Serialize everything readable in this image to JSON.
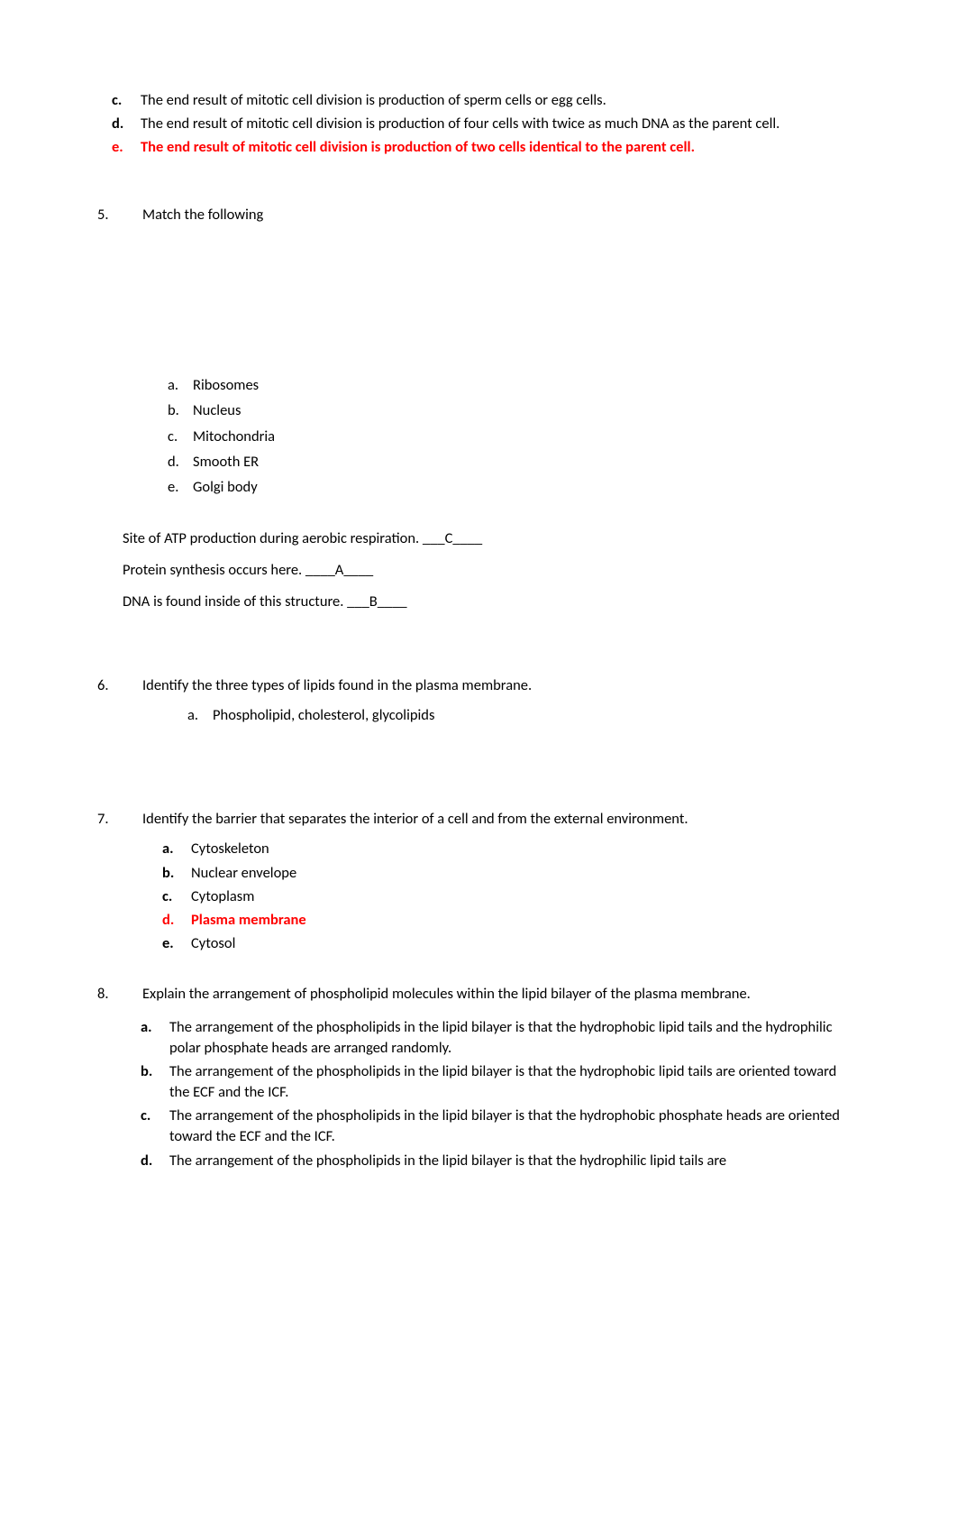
{
  "top": {
    "c": {
      "marker": "c.",
      "text": "The end result of mitotic cell division is production of sperm cells or egg cells."
    },
    "d": {
      "marker": "d.",
      "text": "The end result of mitotic cell division is production of four cells with twice as much DNA as the parent cell."
    },
    "e": {
      "marker": "e.",
      "text": "The end result of mitotic cell division is production of two cells identical to the parent cell."
    }
  },
  "q5": {
    "num": "5.",
    "prompt": "Match the following",
    "opts": {
      "a": {
        "marker": "a.",
        "text": "Ribosomes"
      },
      "b": {
        "marker": "b.",
        "text": "Nucleus"
      },
      "c": {
        "marker": "c.",
        "text": "Mitochondria"
      },
      "d": {
        "marker": "d.",
        "text": "Smooth ER"
      },
      "e": {
        "marker": "e.",
        "text": "Golgi body"
      }
    },
    "stmt1": "Site of ATP production during aerobic respiration. ___C____",
    "stmt2": "Protein synthesis occurs here. ____A____",
    "stmt3": "DNA is found inside of this structure. ___B____"
  },
  "q6": {
    "num": "6.",
    "prompt": "Identify the three types of lipids found in the plasma membrane.",
    "a": {
      "marker": "a.",
      "text": "Phospholipid, cholesterol, glycolipids"
    }
  },
  "q7": {
    "num": "7.",
    "prompt": "Identify the barrier that separates the interior of a cell and from the external environment.",
    "a": {
      "marker": "a.",
      "text": "Cytoskeleton"
    },
    "b": {
      "marker": "b.",
      "text": "Nuclear envelope"
    },
    "c": {
      "marker": "c.",
      "text": "Cytoplasm"
    },
    "d": {
      "marker": "d.",
      "text": "Plasma membrane"
    },
    "e": {
      "marker": "e.",
      "text": "Cytosol"
    }
  },
  "q8": {
    "num": "8.",
    "prompt": "Explain the arrangement of phospholipid molecules within the lipid bilayer of the plasma membrane.",
    "a": {
      "marker": "a.",
      "text": "The arrangement of the phospholipids in the lipid bilayer is that the hydrophobic lipid tails and the hydrophilic polar phosphate heads are arranged randomly."
    },
    "b": {
      "marker": "b.",
      "text": "The arrangement of the phospholipids in the lipid bilayer is that the hydrophobic lipid tails are oriented toward the ECF and the ICF."
    },
    "c": {
      "marker": "c.",
      "text": "The arrangement of the phospholipids in the lipid bilayer is that the hydrophobic phosphate heads are oriented toward the ECF and the ICF."
    },
    "d": {
      "marker": "d.",
      "text": "The arrangement of the phospholipids in the lipid bilayer is that the hydrophilic lipid tails are"
    }
  }
}
